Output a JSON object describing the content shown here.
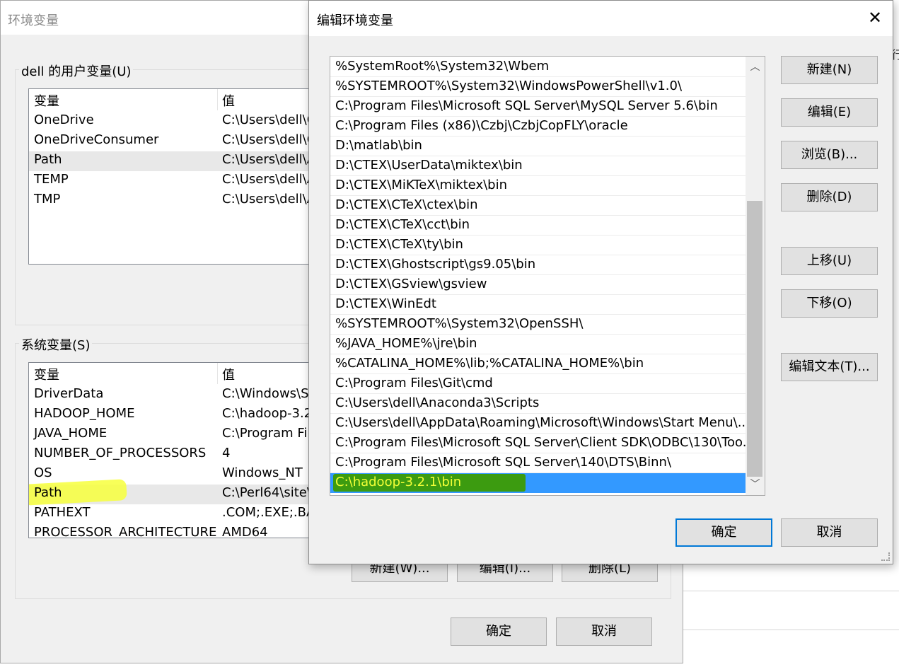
{
  "env_dialog": {
    "title": "环境变量",
    "user_vars": {
      "group_label": "dell 的用户变量(U)",
      "col_name": "变量",
      "col_value": "值",
      "rows": [
        {
          "name": "OneDrive",
          "value": "C:\\Users\\dell\\O"
        },
        {
          "name": "OneDriveConsumer",
          "value": "C:\\Users\\dell\\O"
        },
        {
          "name": "Path",
          "value": "C:\\Users\\dell\\A"
        },
        {
          "name": "TEMP",
          "value": "C:\\Users\\dell\\A"
        },
        {
          "name": "TMP",
          "value": "C:\\Users\\dell\\A"
        }
      ]
    },
    "system_vars": {
      "group_label": "系统变量(S)",
      "col_name": "变量",
      "col_value": "值",
      "rows": [
        {
          "name": "DriverData",
          "value": "C:\\Windows\\Sy"
        },
        {
          "name": "HADOOP_HOME",
          "value": "C:\\hadoop-3.2"
        },
        {
          "name": "JAVA_HOME",
          "value": "C:\\Program Fil"
        },
        {
          "name": "NUMBER_OF_PROCESSORS",
          "value": "4"
        },
        {
          "name": "OS",
          "value": "Windows_NT"
        },
        {
          "name": "Path",
          "value": "C:\\Perl64\\site\\"
        },
        {
          "name": "PATHEXT",
          "value": ".COM;.EXE;.BAT"
        },
        {
          "name": "PROCESSOR_ARCHITECTURE",
          "value": "AMD64"
        }
      ],
      "buttons": {
        "new": "新建(W)...",
        "edit": "编辑(I)...",
        "delete": "删除(L)"
      }
    },
    "ok": "确定",
    "cancel": "取消"
  },
  "edit_dialog": {
    "title": "编辑环境变量",
    "close_glyph": "✕",
    "entries": [
      "%SystemRoot%\\System32\\Wbem",
      "%SYSTEMROOT%\\System32\\WindowsPowerShell\\v1.0\\",
      "C:\\Program Files\\Microsoft SQL Server\\MySQL Server 5.6\\bin",
      "C:\\Program Files (x86)\\Czbj\\CzbjCopFLY\\oracle",
      "D:\\matlab\\bin",
      "D:\\CTEX\\UserData\\miktex\\bin",
      "D:\\CTEX\\MiKTeX\\miktex\\bin",
      "D:\\CTEX\\CTeX\\ctex\\bin",
      "D:\\CTEX\\CTeX\\cct\\bin",
      "D:\\CTEX\\CTeX\\ty\\bin",
      "D:\\CTEX\\Ghostscript\\gs9.05\\bin",
      "D:\\CTEX\\GSview\\gsview",
      "D:\\CTEX\\WinEdt",
      "%SYSTEMROOT%\\System32\\OpenSSH\\",
      "%JAVA_HOME%\\jre\\bin",
      "%CATALINA_HOME%\\lib;%CATALINA_HOME%\\bin",
      "C:\\Program Files\\Git\\cmd",
      "C:\\Users\\dell\\Anaconda3\\Scripts",
      "C:\\Users\\dell\\AppData\\Roaming\\Microsoft\\Windows\\Start Menu\\...",
      "C:\\Program Files\\Microsoft SQL Server\\Client SDK\\ODBC\\130\\Too...",
      "C:\\Program Files\\Microsoft SQL Server\\140\\DTS\\Binn\\",
      "C:\\hadoop-3.2.1\\bin"
    ],
    "selected_index": 21,
    "buttons": {
      "new": "新建(N)",
      "edit": "编辑(E)",
      "browse": "浏览(B)...",
      "delete": "删除(D)",
      "move_up": "上移(U)",
      "move_down": "下移(O)",
      "edit_text": "编辑文本(T)..."
    },
    "ok": "确定",
    "cancel": "取消",
    "scroll_up_glyph": "︿",
    "scroll_down_glyph": "﹀"
  },
  "background_window": {
    "partial_char": "行"
  },
  "colors": {
    "selection": "#3399ff",
    "highlight_green": "#3c9b10",
    "highlight_text": "#f2ff37",
    "marker_yellow": "#f7ff3c",
    "default_button_border": "#0078d7"
  }
}
